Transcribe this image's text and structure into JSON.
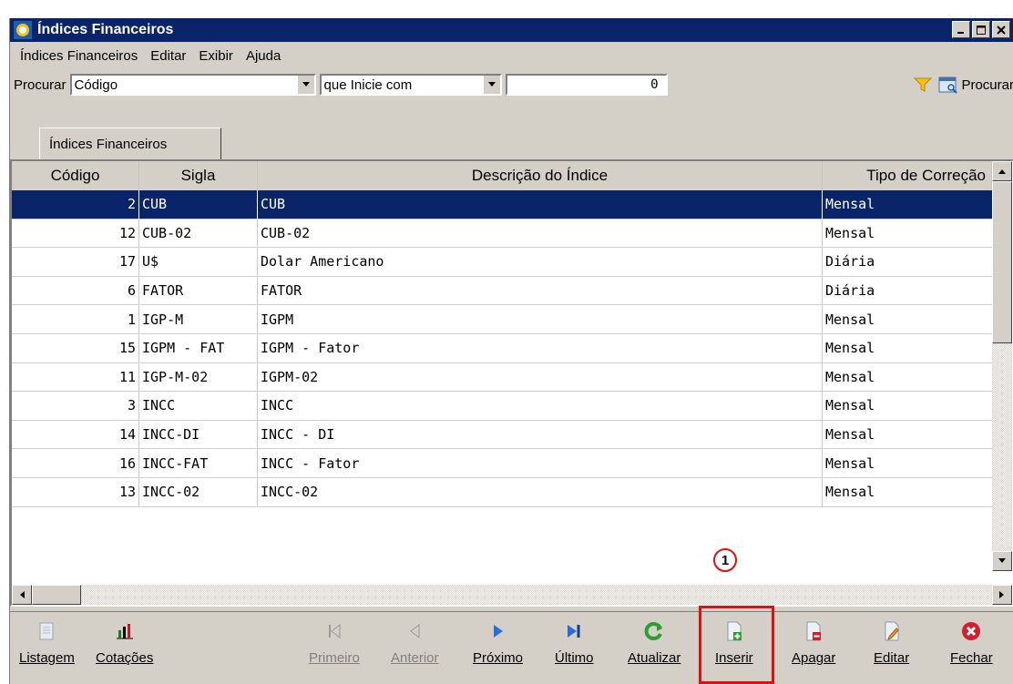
{
  "window": {
    "title": "Índices Financeiros"
  },
  "menu": [
    "Índices Financeiros",
    "Editar",
    "Exibir",
    "Ajuda"
  ],
  "search": {
    "label": "Procurar",
    "field": "Código",
    "condition": "que Inicie com",
    "value": "0",
    "button_label": "Procurar"
  },
  "tab": {
    "label": "Índices Financeiros"
  },
  "grid": {
    "columns": [
      "Código",
      "Sigla",
      "Descrição do Índice",
      "Tipo de Correção"
    ],
    "rows": [
      [
        "2",
        "CUB",
        "CUB",
        "Mensal"
      ],
      [
        "12",
        "CUB-02",
        "CUB-02",
        "Mensal"
      ],
      [
        "17",
        "U$",
        "Dolar Americano",
        "Diária"
      ],
      [
        "6",
        "FATOR",
        "FATOR",
        "Diária"
      ],
      [
        "1",
        "IGP-M",
        "IGPM",
        "Mensal"
      ],
      [
        "15",
        "IGPM - FAT",
        "IGPM - Fator",
        "Mensal"
      ],
      [
        "11",
        "IGP-M-02",
        "IGPM-02",
        "Mensal"
      ],
      [
        "3",
        "INCC",
        "INCC",
        "Mensal"
      ],
      [
        "14",
        "INCC-DI",
        "INCC - DI",
        "Mensal"
      ],
      [
        "16",
        "INCC-FAT",
        "INCC - Fator",
        "Mensal"
      ],
      [
        "13",
        "INCC-02",
        "INCC-02",
        "Mensal"
      ]
    ],
    "selected_row": 0
  },
  "marker": "1",
  "toolbar": {
    "listagem": "Listagem",
    "cotacoes": "Cotações",
    "primeiro": "Primeiro",
    "anterior": "Anterior",
    "proximo": "Próximo",
    "ultimo": "Último",
    "atualizar": "Atualizar",
    "inserir": "Inserir",
    "apagar": "Apagar",
    "editar": "Editar",
    "fechar": "Fechar"
  },
  "colors": {
    "titlebar": "#0a246a",
    "selection": "#0a246a",
    "highlight": "#e01010"
  }
}
